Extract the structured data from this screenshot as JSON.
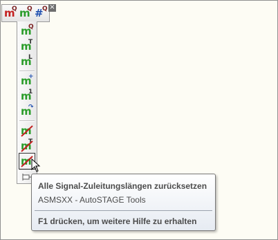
{
  "top_toolbar": {
    "buttons": [
      {
        "name": "measure-red-q-button",
        "glyph": "m",
        "sup": "Q"
      },
      {
        "name": "measure-green-q-button",
        "glyph": "m",
        "sup": "Q"
      },
      {
        "name": "hash-q-button",
        "glyph": "#",
        "sup": "Q"
      }
    ],
    "close_glyph": "×"
  },
  "side_toolbar": {
    "buttons": [
      {
        "name": "m-q-button",
        "glyph": "m",
        "sup": "Q"
      },
      {
        "name": "m-t-button",
        "glyph": "m",
        "sup": "T"
      },
      {
        "name": "m-l-button",
        "glyph": "m",
        "sup": "L"
      },
      {
        "name": "m-plus-button",
        "glyph": "m",
        "sup": "+"
      },
      {
        "name": "m-one-button",
        "glyph": "m",
        "sup": "1"
      },
      {
        "name": "m-arrow-button",
        "glyph": "m",
        "sup": "↷"
      },
      {
        "name": "reset-all-button",
        "glyph": "m",
        "sup": ""
      },
      {
        "name": "reset-t-button",
        "glyph": "m",
        "sup": "T"
      },
      {
        "name": "reset-signal-lengths-button",
        "glyph": "m",
        "sup": ""
      }
    ]
  },
  "tooltip": {
    "title": "Alle Signal-Zuleitungslängen zurücksetzen",
    "subtitle": "ASMSXX - AutoSTAGE Tools",
    "help": "F1 drücken, um weitere Hilfe zu erhalten"
  },
  "colors": {
    "background": "#fdfcf4",
    "glyph_green": "#2a9c2a",
    "glyph_red": "#c32020"
  }
}
